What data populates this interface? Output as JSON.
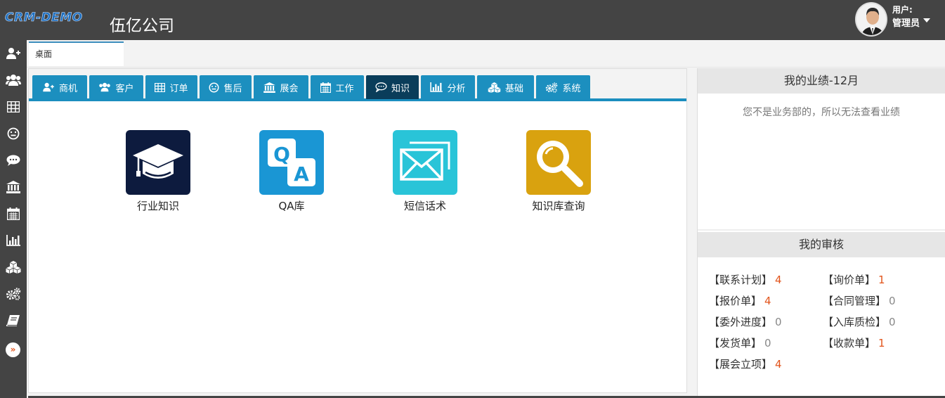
{
  "app": {
    "logo_text": "CRM-DEMO",
    "company": "伍亿公司"
  },
  "user": {
    "label": "用户:",
    "name": "管理员"
  },
  "sidebar": {
    "items": [
      {
        "name": "sidebar-opportunity",
        "icon": "user-plus-icon"
      },
      {
        "name": "sidebar-customer",
        "icon": "users-icon"
      },
      {
        "name": "sidebar-order",
        "icon": "table-icon"
      },
      {
        "name": "sidebar-aftersale",
        "icon": "smile-icon"
      },
      {
        "name": "sidebar-knowledge",
        "icon": "comment-icon"
      },
      {
        "name": "sidebar-exhibition",
        "icon": "bank-icon"
      },
      {
        "name": "sidebar-work",
        "icon": "calendar-icon"
      },
      {
        "name": "sidebar-analysis",
        "icon": "bar-chart-icon"
      },
      {
        "name": "sidebar-base",
        "icon": "cubes-icon"
      },
      {
        "name": "sidebar-system",
        "icon": "gears-icon"
      },
      {
        "name": "sidebar-book",
        "icon": "book-icon"
      }
    ],
    "expand_glyph": "»"
  },
  "tabs": {
    "desktop": "桌面"
  },
  "nav": {
    "items": [
      {
        "label": "商机",
        "icon": "user-plus-icon"
      },
      {
        "label": "客户",
        "icon": "users-icon"
      },
      {
        "label": "订单",
        "icon": "table-icon"
      },
      {
        "label": "售后",
        "icon": "smile-icon"
      },
      {
        "label": "展会",
        "icon": "bank-icon"
      },
      {
        "label": "工作",
        "icon": "calendar-icon"
      },
      {
        "label": "知识",
        "icon": "comment-icon",
        "active": true
      },
      {
        "label": "分析",
        "icon": "bar-chart-icon"
      },
      {
        "label": "基础",
        "icon": "cubes-icon"
      },
      {
        "label": "系统",
        "icon": "gears-icon"
      }
    ],
    "active_color": "#0a3d5a",
    "tab_color": "#1c8fbf"
  },
  "tiles": [
    {
      "label": "行业知识",
      "icon": "graduation-cap-icon",
      "color": "#0d1b3e"
    },
    {
      "label": "QA库",
      "icon": "qa-icon",
      "color": "#1a96d4"
    },
    {
      "label": "短信话术",
      "icon": "envelope-icon",
      "color": "#29c4d8"
    },
    {
      "label": "知识库查询",
      "icon": "magnifier-icon",
      "color": "#d9a20f"
    }
  ],
  "performance": {
    "title": "我的业绩-12月",
    "notice": "您不是业务部的，所以无法查看业绩"
  },
  "audit": {
    "title": "我的审核",
    "items": [
      {
        "label": "【联系计划】",
        "count": "4"
      },
      {
        "label": "【询价单】",
        "count": "1"
      },
      {
        "label": "【报价单】",
        "count": "4"
      },
      {
        "label": "【合同管理】",
        "count": "0"
      },
      {
        "label": "【委外进度】",
        "count": "0"
      },
      {
        "label": "【入库质检】",
        "count": "0"
      },
      {
        "label": "【发货单】",
        "count": "0"
      },
      {
        "label": "【收款单】",
        "count": "1"
      },
      {
        "label": "【展会立项】",
        "count": "4"
      }
    ],
    "nonzero_color": "#e2541b",
    "zero_color": "#888888"
  }
}
